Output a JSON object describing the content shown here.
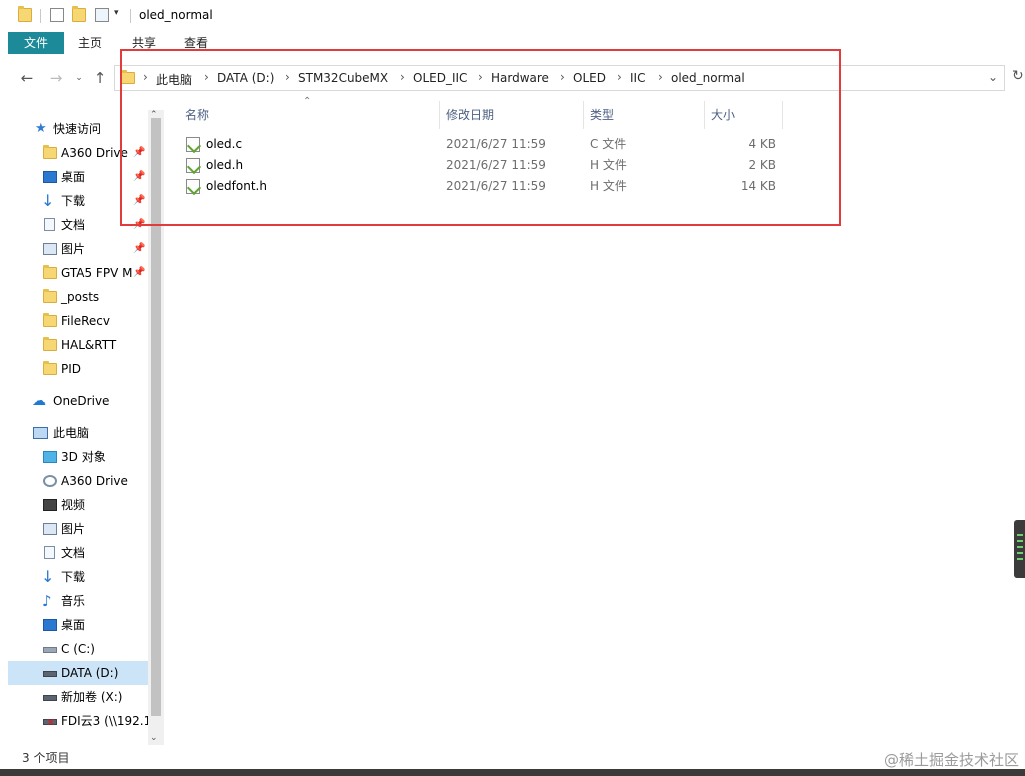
{
  "window": {
    "title": "oled_normal"
  },
  "ribbon": {
    "tabs": [
      "文件",
      "主页",
      "共享",
      "查看"
    ]
  },
  "address": {
    "crumbs": [
      "此电脑",
      "DATA (D:)",
      "STM32CubeMX",
      "OLED_IIC",
      "Hardware",
      "OLED",
      "IIC",
      "oled_normal"
    ]
  },
  "columns": {
    "name": "名称",
    "date": "修改日期",
    "type": "类型",
    "size": "大小"
  },
  "files": [
    {
      "name": "oled.c",
      "date": "2021/6/27 11:59",
      "type": "C 文件",
      "size": "4 KB"
    },
    {
      "name": "oled.h",
      "date": "2021/6/27 11:59",
      "type": "H 文件",
      "size": "2 KB"
    },
    {
      "name": "oledfont.h",
      "date": "2021/6/27 11:59",
      "type": "H 文件",
      "size": "14 KB"
    }
  ],
  "sidebar": {
    "quick_access": "快速访问",
    "quick_items": [
      "A360 Drive",
      "桌面",
      "下载",
      "文档",
      "图片",
      "GTA5 FPV M",
      "_posts",
      "FileRecv",
      "HAL&RTT",
      "PID"
    ],
    "onedrive": "OneDrive",
    "this_pc": "此电脑",
    "pc_items": [
      "3D 对象",
      "A360 Drive",
      "视频",
      "图片",
      "文档",
      "下载",
      "音乐",
      "桌面",
      "C (C:)",
      "DATA (D:)",
      "新加卷 (X:)",
      "FDI云3 (\\\\192.1"
    ]
  },
  "status": {
    "item_count": "3 个项目"
  },
  "watermark": "@稀土掘金技术社区",
  "colors": {
    "accent": "#1c8a99",
    "highlight": "#e23b3b",
    "selected": "#cce4f7"
  }
}
